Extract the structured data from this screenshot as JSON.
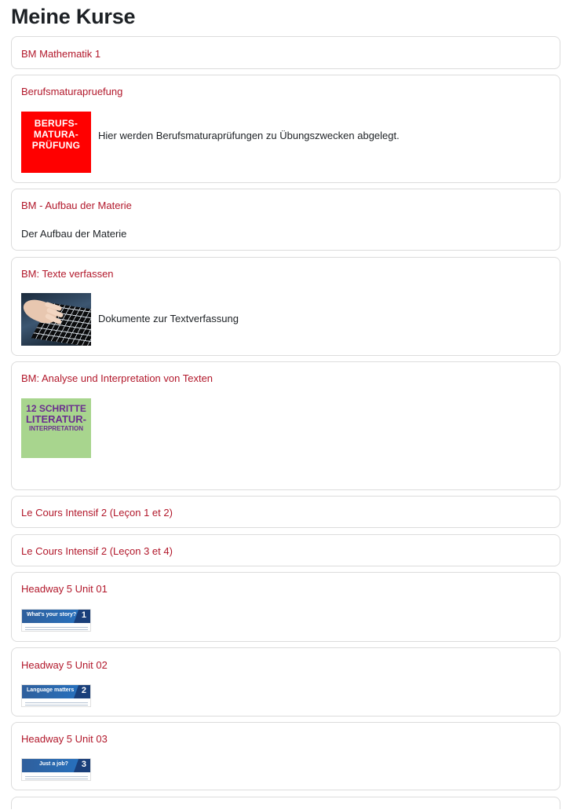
{
  "page": {
    "title": "Meine Kurse"
  },
  "courses": [
    {
      "title": "BM Mathematik 1"
    },
    {
      "title": "Berufsmaturapruefung",
      "thumb_lines": [
        "BERUFS-",
        "MATURA-",
        "PRÜFUNG"
      ],
      "summary": "Hier werden Berufsmaturaprüfungen zu Übungszwecken abgelegt."
    },
    {
      "title": "BM - Aufbau der Materie",
      "summary": "Der Aufbau der Materie"
    },
    {
      "title": "BM: Texte verfassen",
      "summary": "Dokumente zur Textverfassung",
      "thumb_icon": "keyboard-image"
    },
    {
      "title": "BM: Analyse und Interpretation von Texten",
      "thumb_lines": [
        "12 SCHRITTE",
        "LITERATUR-",
        "INTERPRETATION"
      ]
    },
    {
      "title": "Le Cours Intensif 2 (Leçon 1 et 2)"
    },
    {
      "title": "Le Cours Intensif 2 (Leçon 3 et 4)"
    },
    {
      "title": "Headway 5 Unit 01",
      "banner_label": "What's your story?",
      "banner_num": "1"
    },
    {
      "title": "Headway 5 Unit 02",
      "banner_label": "Language matters",
      "banner_num": "2"
    },
    {
      "title": "Headway 5 Unit 03",
      "banner_label": "Just a job?",
      "banner_num": "3"
    }
  ],
  "colors": {
    "link": "#b2182b",
    "border": "#dcdcdc",
    "bm_red": "#ff0000",
    "lit_green": "#a8d58e",
    "lit_purple": "#6a2e8f"
  }
}
